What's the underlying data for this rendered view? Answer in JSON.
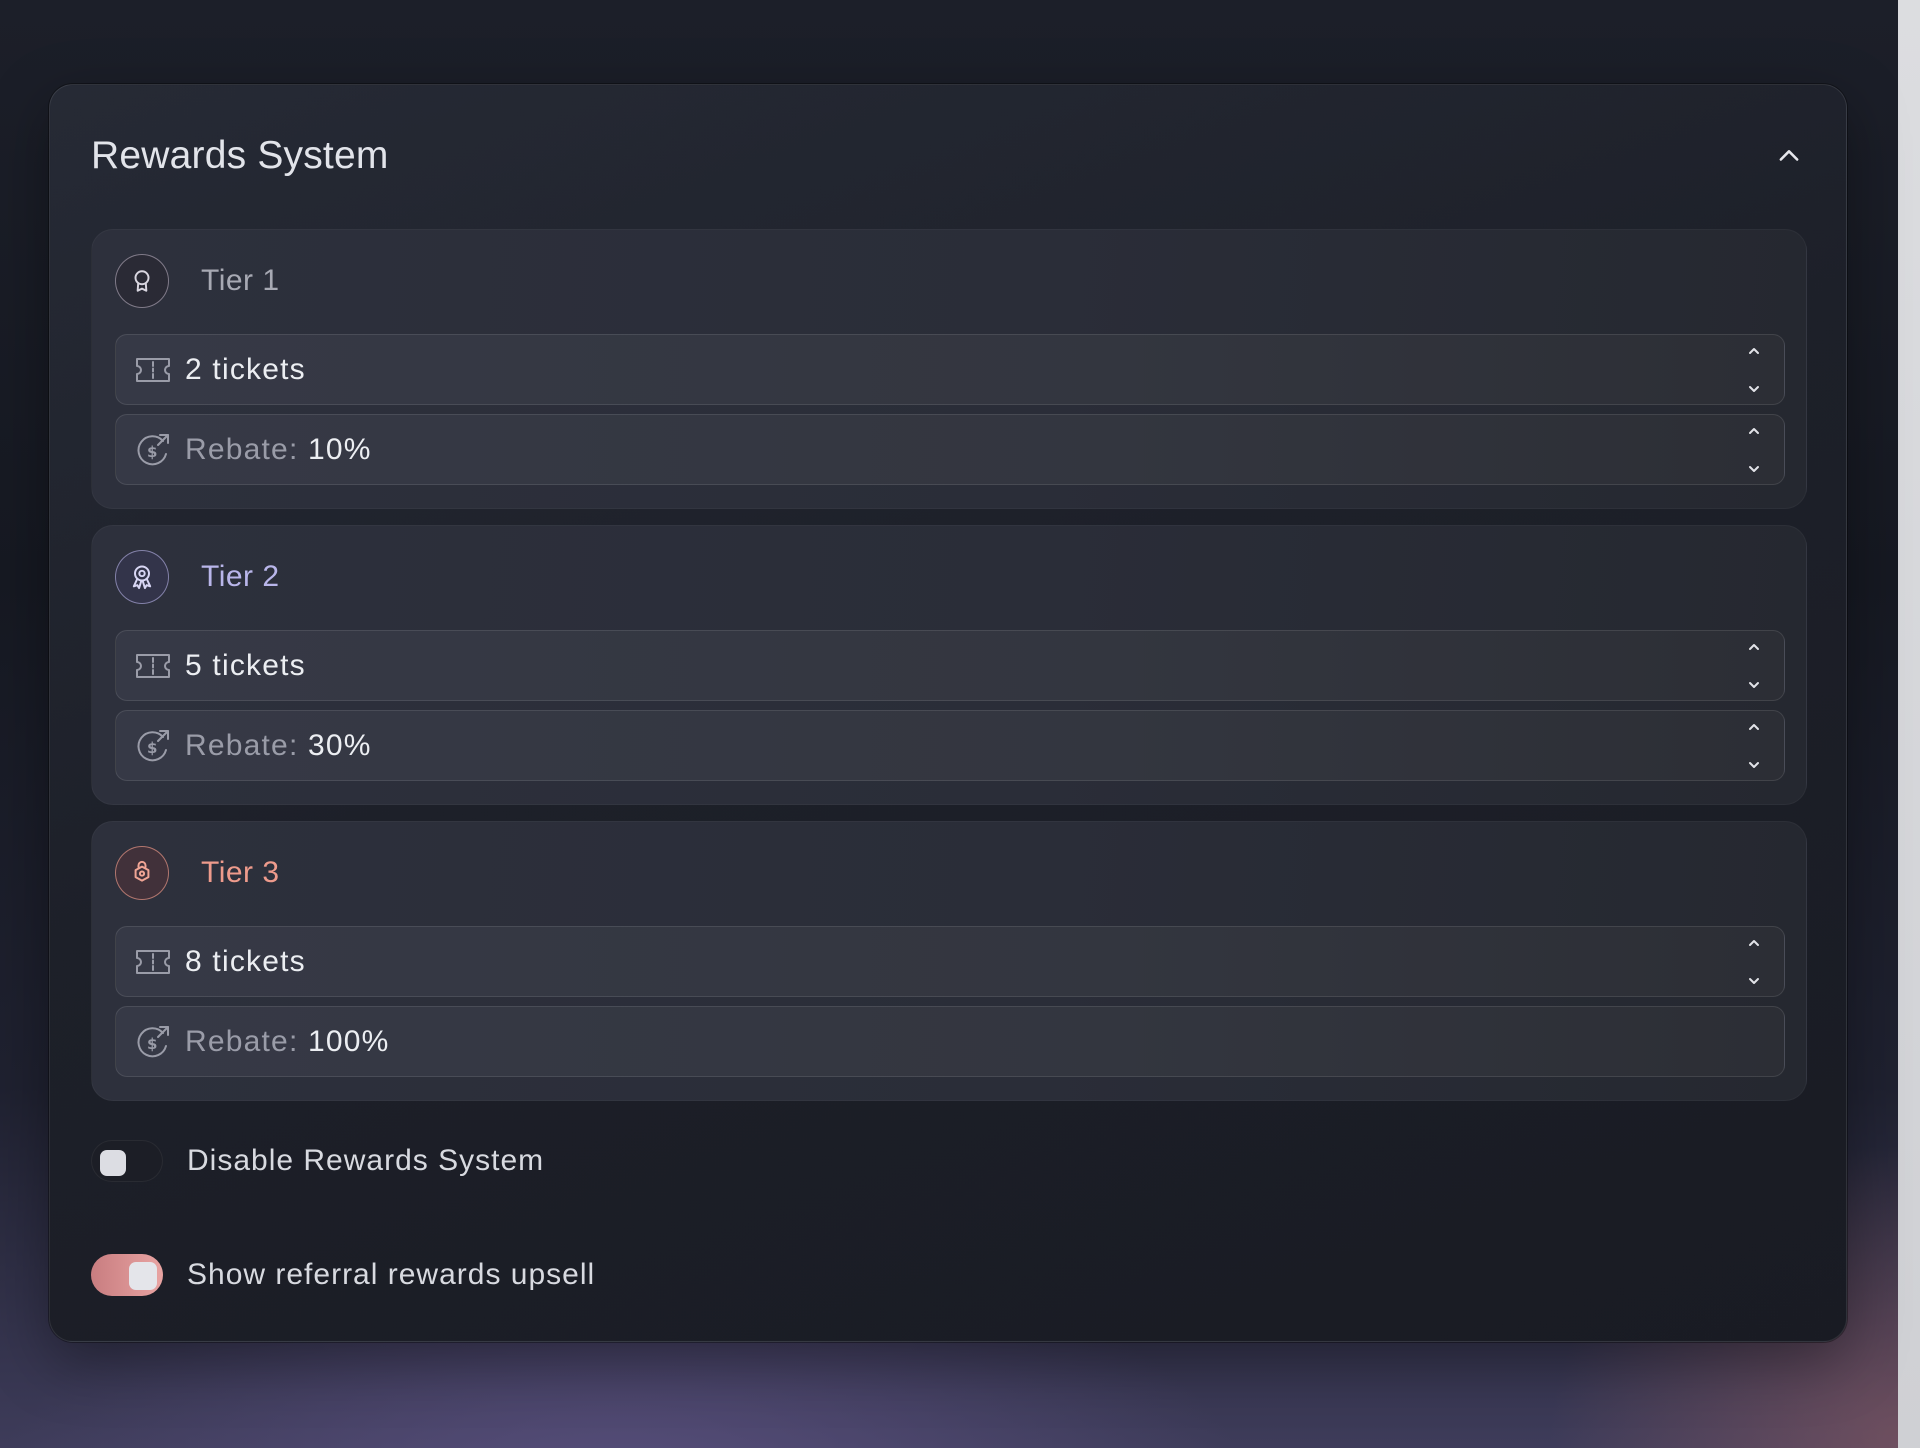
{
  "panel": {
    "title": "Rewards System"
  },
  "tiers": [
    {
      "name": "Tier 1",
      "color": "#a7a9b3",
      "badge_icon": "award-icon",
      "tickets": "2 tickets",
      "rebate_label": "Rebate:",
      "rebate_value": "10%",
      "rebate_has_stepper": true
    },
    {
      "name": "Tier 2",
      "color": "#b9b6ea",
      "badge_icon": "medal-icon",
      "tickets": "5 tickets",
      "rebate_label": "Rebate:",
      "rebate_value": "30%",
      "rebate_has_stepper": true
    },
    {
      "name": "Tier 3",
      "color": "#ee9b8c",
      "badge_icon": "lock-badge-icon",
      "tickets": "8 tickets",
      "rebate_label": "Rebate:",
      "rebate_value": "100%",
      "rebate_has_stepper": false
    }
  ],
  "toggles": {
    "disable_rewards": {
      "label": "Disable Rewards System",
      "on": false
    },
    "referral_upsell": {
      "label": "Show referral rewards upsell",
      "on": true
    }
  },
  "colors": {
    "accent_on": "#e39d9d",
    "text_primary": "#eceef2",
    "text_muted": "#9a9ca8"
  }
}
